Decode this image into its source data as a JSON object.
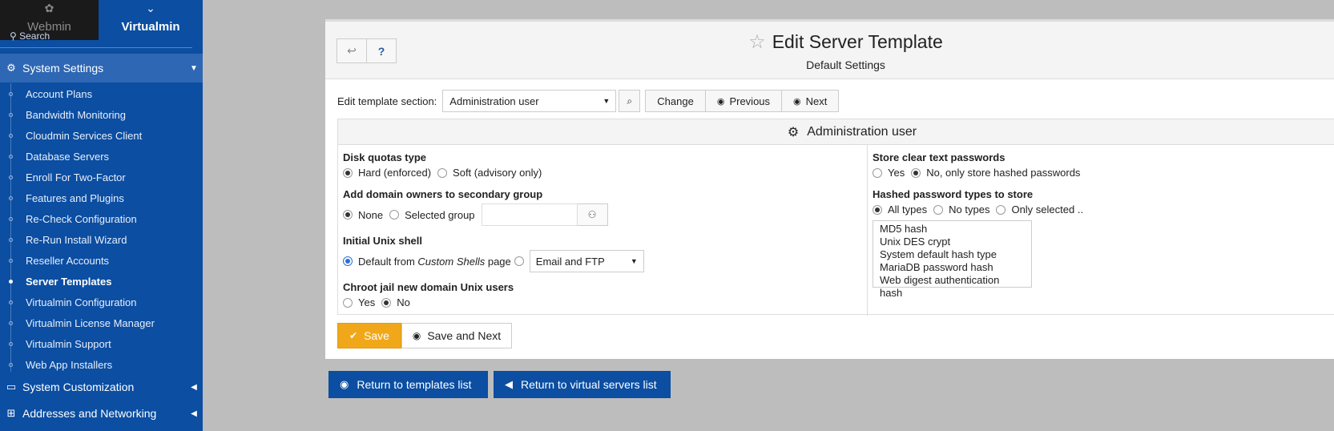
{
  "switcher": {
    "webmin": "Webmin",
    "virtualmin": "Virtualmin"
  },
  "sidebar": {
    "search_placeholder": "Search",
    "system_settings": "System Settings",
    "items": [
      "Account Plans",
      "Bandwidth Monitoring",
      "Cloudmin Services Client",
      "Database Servers",
      "Enroll For Two-Factor",
      "Features and Plugins",
      "Re-Check Configuration",
      "Re-Run Install Wizard",
      "Reseller Accounts",
      "Server Templates",
      "Virtualmin Configuration",
      "Virtualmin License Manager",
      "Virtualmin Support",
      "Web App Installers"
    ],
    "current_item": "Server Templates",
    "system_customization": "System Customization",
    "addresses_networking": "Addresses and Networking"
  },
  "header": {
    "title": "Edit Server Template",
    "subtitle": "Default Settings"
  },
  "template_section": {
    "label": "Edit template section:",
    "selected": "Administration user",
    "change": "Change",
    "previous": "Previous",
    "next": "Next"
  },
  "form": {
    "title": "Administration user",
    "disk_quotas": {
      "label": "Disk quotas type",
      "opt1": "Hard (enforced)",
      "opt2": "Soft (advisory only)"
    },
    "secondary_group": {
      "label": "Add domain owners to secondary group",
      "opt1": "None",
      "opt2": "Selected group"
    },
    "unix_shell": {
      "label": "Initial Unix shell",
      "opt1_prefix": "Default from ",
      "opt1_italic": "Custom Shells",
      "opt1_suffix": " page",
      "select_value": "Email and FTP"
    },
    "chroot": {
      "label": "Chroot jail new domain Unix users",
      "opt1": "Yes",
      "opt2": "No"
    },
    "clear_text": {
      "label": "Store clear text passwords",
      "opt1": "Yes",
      "opt2": "No, only store hashed passwords"
    },
    "hash_types": {
      "label": "Hashed password types to store",
      "opt1": "All types",
      "opt2": "No types",
      "opt3": "Only selected ..",
      "list": [
        "MD5 hash",
        "Unix DES crypt",
        "System default hash type",
        "MariaDB password hash",
        "Web digest authentication hash"
      ]
    }
  },
  "actions": {
    "save": "Save",
    "save_next": "Save and Next"
  },
  "returns": {
    "templates": "Return to templates list",
    "servers": "Return to virtual servers list"
  },
  "colors": {
    "sidebar_bg": "#0b4ea2",
    "save_bg": "#f0a81a",
    "return_bg": "#0b4ea2"
  }
}
